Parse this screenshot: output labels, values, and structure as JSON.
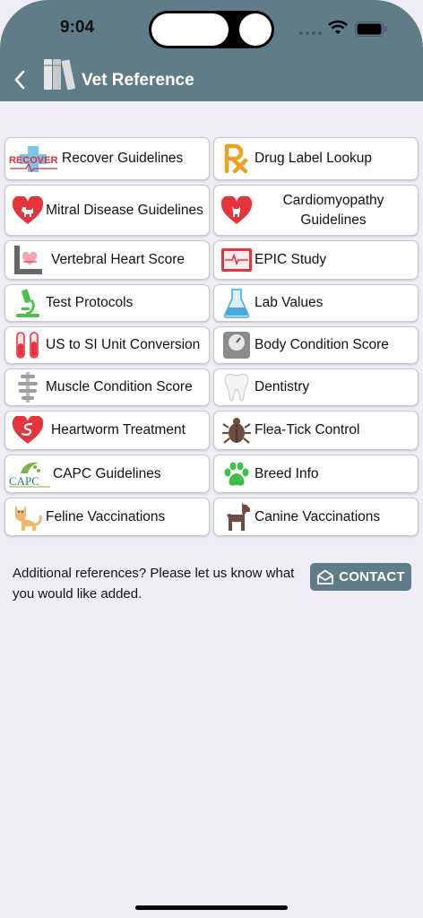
{
  "status": {
    "time": "9:04"
  },
  "header": {
    "title": "Vet Reference"
  },
  "cards": [
    {
      "id": "recover",
      "label": "Recover Guidelines",
      "icon": "recover-logo-icon",
      "brand": "RECOVER"
    },
    {
      "id": "drug",
      "label": "Drug Label Lookup",
      "icon": "rx-icon"
    },
    {
      "id": "mitral",
      "label": "Mitral Disease Guidelines",
      "icon": "heart-dog-icon"
    },
    {
      "id": "cardio",
      "label": "Cardiomyopathy Guidelines",
      "icon": "heart-cat-icon"
    },
    {
      "id": "vhs",
      "label": "Vertebral Heart Score",
      "icon": "vertebral-heart-icon"
    },
    {
      "id": "epic",
      "label": "EPIC Study",
      "icon": "ecg-monitor-icon"
    },
    {
      "id": "protocols",
      "label": "Test Protocols",
      "icon": "microscope-icon"
    },
    {
      "id": "lab",
      "label": "Lab Values",
      "icon": "flask-icon"
    },
    {
      "id": "units",
      "label": "US to SI Unit Conversion",
      "icon": "test-tubes-icon"
    },
    {
      "id": "bcs",
      "label": "Body Condition Score",
      "icon": "scale-icon"
    },
    {
      "id": "mcs",
      "label": "Muscle Condition Score",
      "icon": "spine-icon"
    },
    {
      "id": "dentistry",
      "label": "Dentistry",
      "icon": "tooth-icon"
    },
    {
      "id": "heartworm",
      "label": "Heartworm Treatment",
      "icon": "heartworm-icon"
    },
    {
      "id": "flea",
      "label": "Flea-Tick Control",
      "icon": "tick-icon"
    },
    {
      "id": "capc",
      "label": "CAPC Guidelines",
      "icon": "capc-logo-icon",
      "brand": "CAPC"
    },
    {
      "id": "breed",
      "label": "Breed Info",
      "icon": "paw-icon"
    },
    {
      "id": "feline",
      "label": "Feline Vaccinations",
      "icon": "cat-icon"
    },
    {
      "id": "canine",
      "label": "Canine Vaccinations",
      "icon": "dog-icon"
    }
  ],
  "footer": {
    "message": "Additional references? Please let us know what you would like added.",
    "contact_label": "CONTACT"
  },
  "colors": {
    "header": "#5f7c88",
    "background": "#efeef4",
    "heart_red": "#e5343c"
  }
}
